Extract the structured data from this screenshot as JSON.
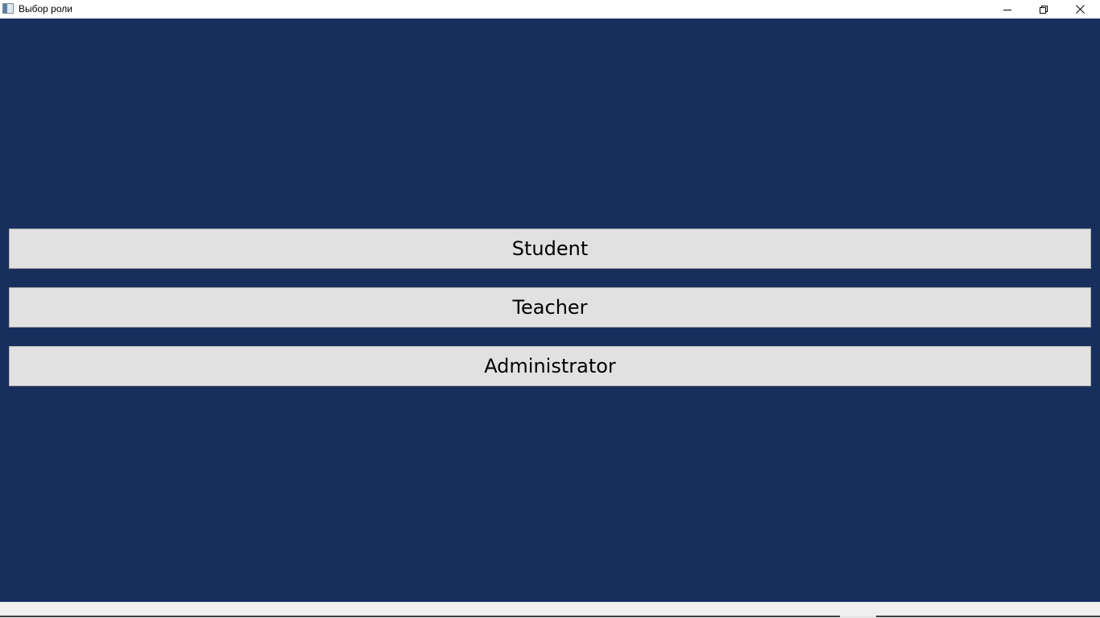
{
  "window": {
    "title": "Выбор роли",
    "icon": "app-window-icon",
    "controls": {
      "minimize": "minimize-icon",
      "restore": "restore-icon",
      "close": "close-icon"
    }
  },
  "roles": {
    "student_label": "Student",
    "teacher_label": "Teacher",
    "administrator_label": "Administrator"
  },
  "colors": {
    "background": "#182f5e",
    "button_face": "#e1e1e1",
    "button_border": "#adadad",
    "titlebar": "#ffffff"
  }
}
